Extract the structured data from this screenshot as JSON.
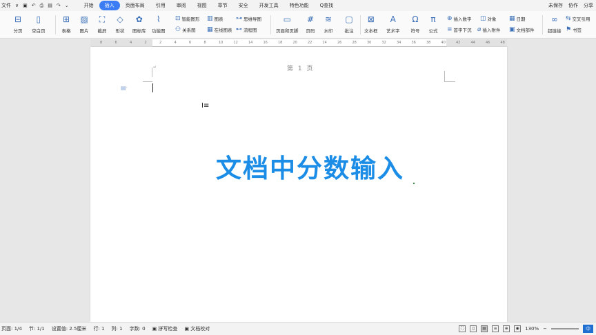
{
  "menubar": {
    "file_label": "文件",
    "tabs": [
      {
        "label": "开始",
        "active": false
      },
      {
        "label": "插入",
        "active": true
      },
      {
        "label": "页面布局",
        "active": false
      },
      {
        "label": "引用",
        "active": false
      },
      {
        "label": "审阅",
        "active": false
      },
      {
        "label": "视图",
        "active": false
      },
      {
        "label": "章节",
        "active": false
      },
      {
        "label": "安全",
        "active": false
      },
      {
        "label": "开发工具",
        "active": false
      },
      {
        "label": "特色功能",
        "active": false
      },
      {
        "label": "Q查找",
        "active": false
      }
    ],
    "right": [
      "未保存",
      "协作",
      "分享"
    ]
  },
  "ribbon": {
    "big": [
      {
        "label": "分页",
        "icon": "page-break-icon"
      },
      {
        "label": "空白页",
        "icon": "blank-page-icon"
      },
      {
        "label": "表格",
        "icon": "table-icon"
      },
      {
        "label": "图片",
        "icon": "picture-icon"
      },
      {
        "label": "截屏",
        "icon": "screenshot-icon"
      },
      {
        "label": "形状",
        "icon": "shape-icon"
      },
      {
        "label": "图标库",
        "icon": "icon-library-icon"
      },
      {
        "label": "功能图",
        "icon": "function-chart-icon"
      },
      {
        "label": "页眉和页脚",
        "icon": "header-footer-icon"
      },
      {
        "label": "页码",
        "icon": "page-number-icon"
      },
      {
        "label": "水印",
        "icon": "watermark-icon"
      },
      {
        "label": "批注",
        "icon": "comment-icon"
      },
      {
        "label": "文本框",
        "icon": "textbox-icon"
      },
      {
        "label": "艺术字",
        "icon": "wordart-icon"
      },
      {
        "label": "符号",
        "icon": "symbol-icon"
      },
      {
        "label": "公式",
        "icon": "formula-icon"
      },
      {
        "label": "超链接",
        "icon": "hyperlink-icon"
      }
    ],
    "small": [
      {
        "label": "智能图形",
        "icon": "smart-art-icon"
      },
      {
        "label": "图表",
        "icon": "chart-icon"
      },
      {
        "label": "思维导图",
        "icon": "mindmap-icon"
      },
      {
        "label": "关系图",
        "icon": "relation-icon"
      },
      {
        "label": "在线图表",
        "icon": "online-chart-icon"
      },
      {
        "label": "流程图",
        "icon": "flowchart-icon"
      },
      {
        "label": "插入数字",
        "icon": "insert-number-icon"
      },
      {
        "label": "对象",
        "icon": "object-icon"
      },
      {
        "label": "日期",
        "icon": "date-icon"
      },
      {
        "label": "首字下沉",
        "icon": "drop-cap-icon"
      },
      {
        "label": "插入附件",
        "icon": "attachment-icon"
      },
      {
        "label": "文档部件",
        "icon": "doc-parts-icon"
      },
      {
        "label": "交叉引用",
        "icon": "cross-ref-icon"
      },
      {
        "label": "书签",
        "icon": "bookmark-icon"
      }
    ]
  },
  "ruler": {
    "ticks": [
      "8",
      "6",
      "4",
      "2",
      "2",
      "4",
      "6",
      "8",
      "10",
      "12",
      "14",
      "16",
      "18",
      "20",
      "22",
      "24",
      "26",
      "28",
      "30",
      "32",
      "34",
      "36",
      "38",
      "40",
      "42",
      "44",
      "46",
      "48"
    ]
  },
  "document": {
    "header_label": "第 1 页",
    "headline": "文档中分数输入",
    "headline_color": "#1b8de6"
  },
  "statusbar": {
    "page": "页面: 1/4",
    "section": "节: 1/1",
    "setting": "设置值: 2.5厘米",
    "line": "行: 1",
    "column": "列: 1",
    "wordcount": "字数: 0",
    "spellcheck": "拼写检查",
    "proofread": "文档校对",
    "zoom": "130%",
    "ime": "中"
  }
}
